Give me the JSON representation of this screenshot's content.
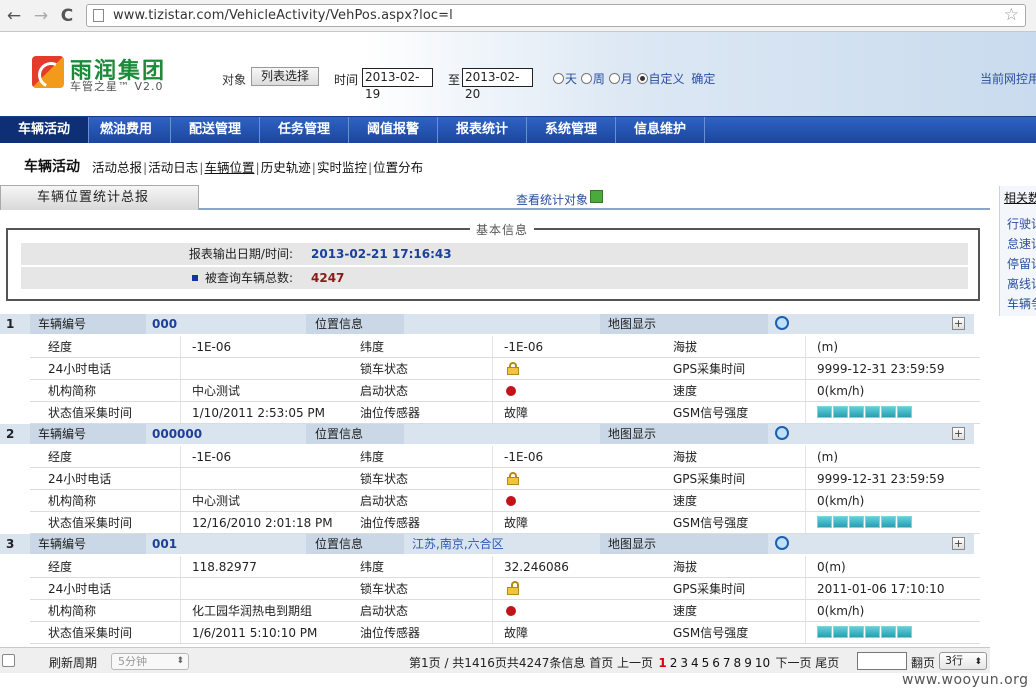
{
  "browser": {
    "url": "www.tizistar.com/VehicleActivity/VehPos.aspx?loc=l",
    "back": "←",
    "forward": "→",
    "reload": "C",
    "star": "☆"
  },
  "header": {
    "logo_title": "雨润集团",
    "logo_sub": "车管之星™ V2.0",
    "object_label": "对象",
    "list_button": "列表选择",
    "time_label": "时间",
    "date_from": "2013-02-19",
    "to_label": "至",
    "date_to": "2013-02-20",
    "radios": [
      {
        "label": "天",
        "checked": false
      },
      {
        "label": "周",
        "checked": false
      },
      {
        "label": "月",
        "checked": false
      },
      {
        "label": "自定义",
        "checked": true
      }
    ],
    "confirm": "确定",
    "current": "当前网控用"
  },
  "main_nav": [
    "车辆活动",
    "燃油费用",
    "配送管理",
    "任务管理",
    "阈值报警",
    "报表统计",
    "系统管理",
    "信息维护"
  ],
  "sub_nav": {
    "title": "车辆活动",
    "links": [
      "活动总报",
      "活动日志",
      "车辆位置",
      "历史轨迹",
      "实时监控",
      "位置分布"
    ],
    "active": "车辆位置"
  },
  "section": {
    "tab": "车辆位置统计总报",
    "view_stats": "查看统计对象"
  },
  "side_panel": {
    "header": "相关数",
    "links": [
      "行驶记",
      "怠速记",
      "停留记",
      "离线记",
      "车辆争"
    ]
  },
  "basic_info": {
    "legend": "基本信息",
    "rows": [
      {
        "key": "报表输出日期/时间:",
        "value": "2013-02-21 17:16:43",
        "color": "#1d3f9c"
      },
      {
        "key": "被查询车辆总数:",
        "value": "4247",
        "color": "#8b1a1a"
      }
    ]
  },
  "record_labels": {
    "vehicle_no": "车辆编号",
    "location": "位置信息",
    "map": "地图显示",
    "lng": "经度",
    "lat": "纬度",
    "alt": "海拔",
    "phone": "24小时电话",
    "lock": "锁车状态",
    "gps_time": "GPS采集时间",
    "org": "机构简称",
    "start": "启动状态",
    "speed": "速度",
    "status_time": "状态值采集时间",
    "oil": "油位传感器",
    "gsm": "GSM信号强度"
  },
  "records": [
    {
      "num": "1",
      "vehicle_no": "000",
      "location": "",
      "lng": "-1E-06",
      "lat": "-1E-06",
      "alt": "(m)",
      "phone": "",
      "gps_time": "9999-12-31 23:59:59",
      "org": "中心测试",
      "speed": "0(km/h)",
      "status_time": "1/10/2011 2:53:05 PM",
      "oil": "故障",
      "lock_icon": "lock-icon",
      "start_icon": "red-dot-icon",
      "gsm_bars": 6
    },
    {
      "num": "2",
      "vehicle_no": "000000",
      "location": "",
      "lng": "-1E-06",
      "lat": "-1E-06",
      "alt": "(m)",
      "phone": "",
      "gps_time": "9999-12-31 23:59:59",
      "org": "中心测试",
      "speed": "0(km/h)",
      "status_time": "12/16/2010 2:01:18 PM",
      "oil": "故障",
      "lock_icon": "lock-icon",
      "start_icon": "red-dot-icon",
      "gsm_bars": 6
    },
    {
      "num": "3",
      "vehicle_no": "001",
      "location": "江苏,南京,六合区",
      "lng": "118.82977",
      "lat": "32.246086",
      "alt": "0(m)",
      "phone": "",
      "gps_time": "2011-01-06 17:10:10",
      "org": "化工园华润热电到期组",
      "speed": "0(km/h)",
      "status_time": "1/6/2011 5:10:10 PM",
      "oil": "故障",
      "lock_icon": "unlock-icon",
      "start_icon": "red-dot-icon",
      "gsm_bars": 6
    }
  ],
  "footer": {
    "refresh_label": "刷新周期",
    "refresh_value": "5分钟",
    "pager_prefix": "第1页 / 共1416页共4247条信息 首页 上一页",
    "pages": [
      "1",
      "2",
      "3",
      "4",
      "5",
      "6",
      "7",
      "8",
      "9",
      "10"
    ],
    "current_page": "1",
    "pager_suffix": "下一页 尾页",
    "goto_label": "翻页",
    "rows_value": "3行"
  },
  "watermark": "www.wooyun.org"
}
